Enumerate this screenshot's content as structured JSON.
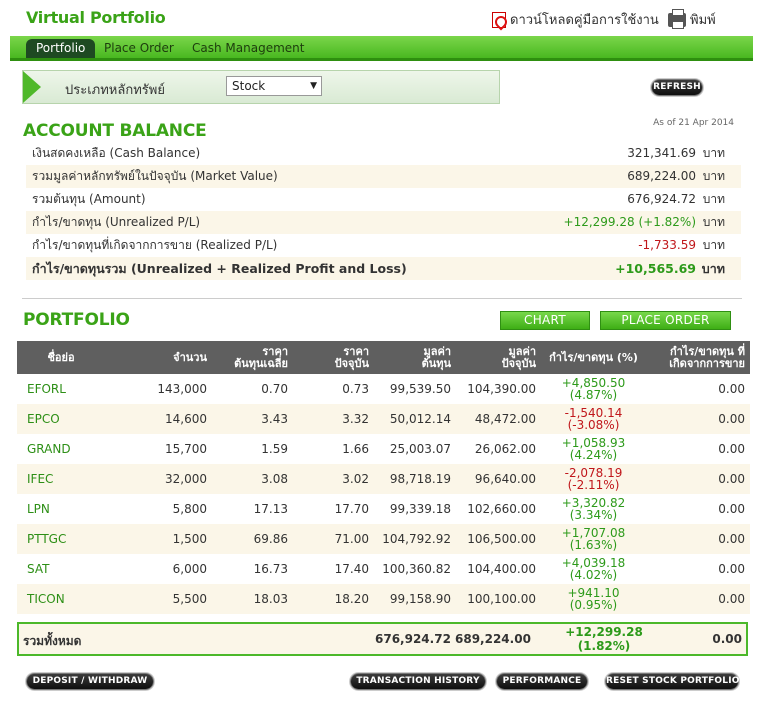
{
  "header": {
    "app_title": "Virtual Portfolio",
    "download_label": "ดาวน์โหลดคู่มือการใช้งาน",
    "print_label": "พิมพ์"
  },
  "tabs": [
    {
      "label": "Portfolio",
      "active": true
    },
    {
      "label": "Place Order",
      "active": false
    },
    {
      "label": "Cash Management",
      "active": false
    }
  ],
  "filter": {
    "label": "ประเภทหลักทรัพย์",
    "selected": "Stock"
  },
  "refresh_label": "REFRESH",
  "account": {
    "title": "ACCOUNT BALANCE",
    "as_of": "As of 21 Apr 2014",
    "rows": [
      {
        "label": "เงินสดคงเหลือ (Cash Balance)",
        "value": "321,341.69",
        "unit": "บาท",
        "tone": "neutral"
      },
      {
        "label": "รวมมูลค่าหลักทรัพย์ในปัจจุบัน (Market Value)",
        "value": "689,224.00",
        "unit": "บาท",
        "tone": "neutral"
      },
      {
        "label": "รวมต้นทุน (Amount)",
        "value": "676,924.72",
        "unit": "บาท",
        "tone": "neutral"
      },
      {
        "label": "กำไร/ขาดทุน (Unrealized P/L)",
        "value": "+12,299.28 (+1.82%)",
        "unit": "บาท",
        "tone": "green"
      },
      {
        "label": "กำไร/ขาดทุนที่เกิดจากการขาย (Realized P/L)",
        "value": "-1,733.59",
        "unit": "บาท",
        "tone": "red"
      },
      {
        "label": "กำไร/ขาดทุนรวม (Unrealized + Realized Profit and Loss)",
        "value": "+10,565.69",
        "unit": "บาท",
        "tone": "green"
      }
    ]
  },
  "portfolio": {
    "title": "PORTFOLIO",
    "chart_label": "CHART",
    "place_order_label": "PLACE ORDER",
    "columns": {
      "symbol": "ชื่อย่อ",
      "qty": "จำนวน",
      "avg_cost_1": "ราคา",
      "avg_cost_2": "ต้นทุนเฉลี่ย",
      "price_1": "ราคา",
      "price_2": "ปัจจุบัน",
      "cost_1": "มูลค่า",
      "cost_2": "ต้นทุน",
      "mkt_1": "มูลค่า",
      "mkt_2": "ปัจจุบัน",
      "pl": "กำไร/ขาดทุน (%)",
      "realized_1": "กำไร/ขาดทุน ที่",
      "realized_2": "เกิดจากการขาย"
    },
    "rows": [
      {
        "symbol": "EFORL",
        "qty": "143,000",
        "avg": "0.70",
        "price": "0.73",
        "cost": "99,539.50",
        "mkt": "104,390.00",
        "pl": "+4,850.50",
        "pct": "(4.87%)",
        "tone": "green",
        "realized": "0.00"
      },
      {
        "symbol": "EPCO",
        "qty": "14,600",
        "avg": "3.43",
        "price": "3.32",
        "cost": "50,012.14",
        "mkt": "48,472.00",
        "pl": "-1,540.14",
        "pct": "(-3.08%)",
        "tone": "red",
        "realized": "0.00"
      },
      {
        "symbol": "GRAND",
        "qty": "15,700",
        "avg": "1.59",
        "price": "1.66",
        "cost": "25,003.07",
        "mkt": "26,062.00",
        "pl": "+1,058.93",
        "pct": "(4.24%)",
        "tone": "green",
        "realized": "0.00"
      },
      {
        "symbol": "IFEC",
        "qty": "32,000",
        "avg": "3.08",
        "price": "3.02",
        "cost": "98,718.19",
        "mkt": "96,640.00",
        "pl": "-2,078.19",
        "pct": "(-2.11%)",
        "tone": "red",
        "realized": "0.00"
      },
      {
        "symbol": "LPN",
        "qty": "5,800",
        "avg": "17.13",
        "price": "17.70",
        "cost": "99,339.18",
        "mkt": "102,660.00",
        "pl": "+3,320.82",
        "pct": "(3.34%)",
        "tone": "green",
        "realized": "0.00"
      },
      {
        "symbol": "PTTGC",
        "qty": "1,500",
        "avg": "69.86",
        "price": "71.00",
        "cost": "104,792.92",
        "mkt": "106,500.00",
        "pl": "+1,707.08",
        "pct": "(1.63%)",
        "tone": "green",
        "realized": "0.00"
      },
      {
        "symbol": "SAT",
        "qty": "6,000",
        "avg": "16.73",
        "price": "17.40",
        "cost": "100,360.82",
        "mkt": "104,400.00",
        "pl": "+4,039.18",
        "pct": "(4.02%)",
        "tone": "green",
        "realized": "0.00"
      },
      {
        "symbol": "TICON",
        "qty": "5,500",
        "avg": "18.03",
        "price": "18.20",
        "cost": "99,158.90",
        "mkt": "100,100.00",
        "pl": "+941.10",
        "pct": "(0.95%)",
        "tone": "green",
        "realized": "0.00"
      }
    ],
    "total": {
      "label": "รวมทั้งหมด",
      "cost": "676,924.72",
      "mkt": "689,224.00",
      "pl": "+12,299.28",
      "pct": "(1.82%)",
      "realized": "0.00"
    }
  },
  "footer_buttons": {
    "deposit": "DEPOSIT / WITHDRAW",
    "history": "TRANSACTION HISTORY",
    "performance": "PERFORMANCE",
    "reset": "RESET STOCK PORTFOLIO"
  },
  "colors": {
    "brand_green": "#3aa317",
    "positive": "#2d9a1a",
    "negative": "#c0171b",
    "table_header": "#5f5f5f",
    "row_alt": "#fbf6e8"
  }
}
